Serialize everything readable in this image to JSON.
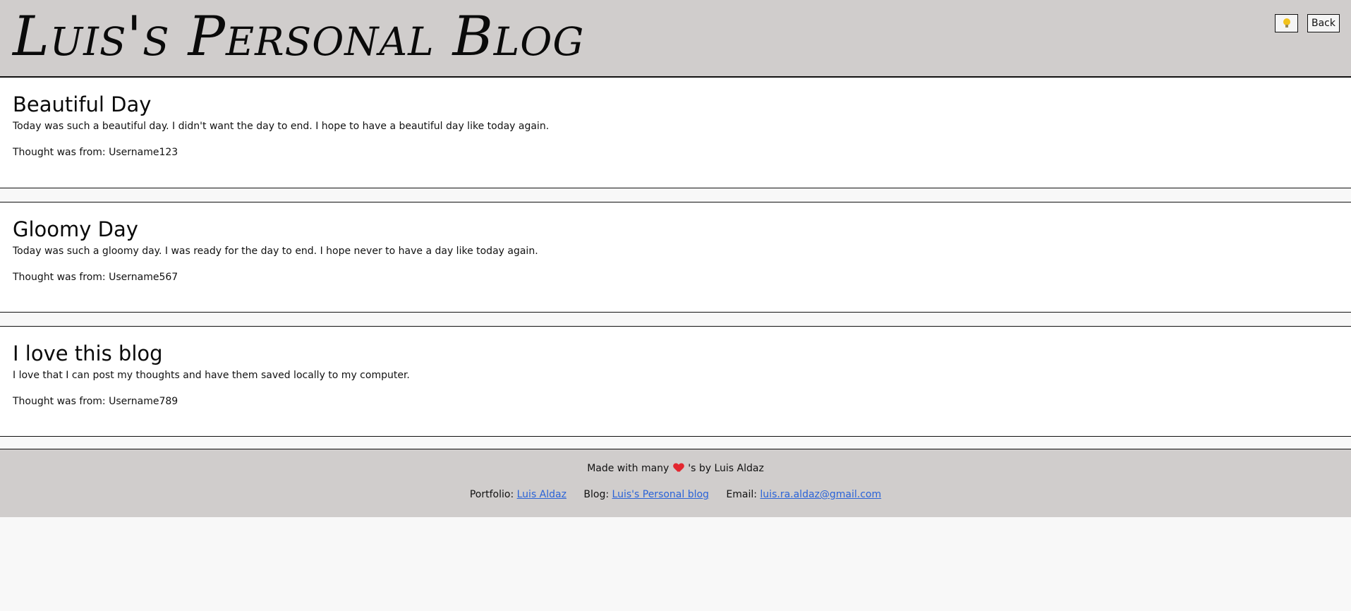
{
  "header": {
    "title": "Luis's Personal Blog",
    "theme_toggle_icon": "lightbulb-icon",
    "back_label": "Back"
  },
  "posts": [
    {
      "title": "Beautiful Day",
      "body": "Today was such a beautiful day. I didn't want the day to end. I hope to have a beautiful day like today again.",
      "author_line": "Thought was from: Username123"
    },
    {
      "title": "Gloomy Day",
      "body": "Today was such a gloomy day. I was ready for the day to end. I hope never to have a day like today again.",
      "author_line": "Thought was from: Username567"
    },
    {
      "title": "I love this blog",
      "body": "I love that I can post my thoughts and have them saved locally to my computer.",
      "author_line": "Thought was from: Username789"
    }
  ],
  "footer": {
    "made_with_prefix": "Made with many",
    "made_with_icon": "heart-icon",
    "made_with_suffix": "'s by Luis Aldaz",
    "portfolio_label": "Portfolio:",
    "portfolio_link": "Luis Aldaz",
    "blog_label": "Blog:",
    "blog_link": "Luis's Personal blog",
    "email_label": "Email:",
    "email_link": "luis.ra.aldaz@gmail.com"
  },
  "colors": {
    "header_bg": "#d0cdcc",
    "page_bg": "#f8f8f8",
    "post_bg": "#ffffff",
    "link": "#2a63d8",
    "heart": "#e3262f",
    "bulb": "#f2c21b"
  }
}
